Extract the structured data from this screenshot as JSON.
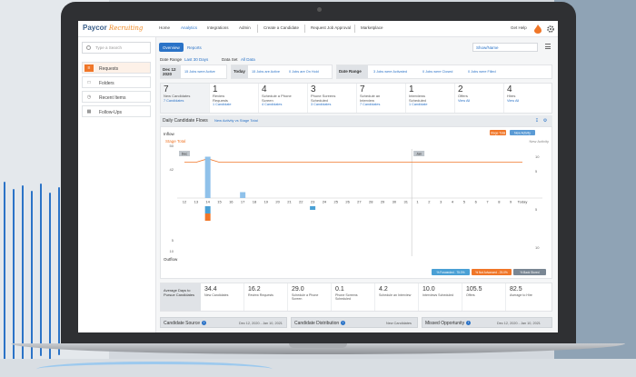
{
  "nav": {
    "logo_text": "Paycor",
    "logo_script": "Recruiting",
    "items": [
      "Home",
      "Analytics",
      "Integrations",
      "Admin",
      "Create a Candidate",
      "Request Job Approval",
      "Marketplace"
    ],
    "active_index": 1,
    "help": "Get Help"
  },
  "sidebar": {
    "search_placeholder": "Type a Search",
    "items": [
      {
        "label": "Requests",
        "icon": "requests-icon",
        "active": true
      },
      {
        "label": "Folders",
        "icon": "folder-icon",
        "active": false
      },
      {
        "label": "Recent Items",
        "icon": "clock-icon",
        "active": false
      },
      {
        "label": "Follow-Ups",
        "icon": "calendar-icon",
        "active": false
      }
    ]
  },
  "tabs": [
    "Overview",
    "Reports"
  ],
  "show_select": "Show/Name",
  "date_range": {
    "label": "Date Range",
    "value": "Last 30 Days",
    "set_label": "Data Set",
    "set_value": "All Data"
  },
  "periods": [
    {
      "head": "Dec 12 2020",
      "links": [
        "15 Jobs were Active"
      ]
    },
    {
      "head": "Today",
      "links": [
        "15 Jobs are Active",
        "0 Jobs are On Hold"
      ]
    },
    {
      "head": "Date Range",
      "links": [
        "3 Jobs were Activated",
        "0 Jobs were Closed",
        "0 Jobs were Filled"
      ]
    }
  ],
  "stats": [
    {
      "num": "7",
      "label": "New Candidates",
      "sub": "7 Candidates"
    },
    {
      "num": "1",
      "label": "Review Requests",
      "sub": "1 Candidate"
    },
    {
      "num": "4",
      "label": "Schedule a Phone Screen",
      "sub": "4 Candidates"
    },
    {
      "num": "3",
      "label": "Phone Screens Scheduled",
      "sub": "3 Candidates"
    },
    {
      "num": "7",
      "label": "Schedule an Interview",
      "sub": "7 Candidates"
    },
    {
      "num": "1",
      "label": "Interviews Scheduled",
      "sub": "1 Candidate"
    },
    {
      "num": "2",
      "label": "Offers",
      "sub": "View All"
    },
    {
      "num": "4",
      "label": "Hires",
      "sub": "View All"
    }
  ],
  "chart_head": {
    "title": "Daily Candidate Flows",
    "select": "New Activity vs Stage Total"
  },
  "chart_data": {
    "type": "bar",
    "legend_top": [
      "Stage Total",
      "New Activity"
    ],
    "legend_bottom": [
      "% Forwarded - 75.0%",
      "% Not Advanced - 25.0%",
      "% Back Stored"
    ],
    "inflow_label": "Inflow",
    "outflow_label": "Outflow",
    "stage_total_label": "Stage Total",
    "new_activity_label": "New Activity",
    "month_markers": [
      "Dec",
      "Jan"
    ],
    "y_left_ticks": [
      "50",
      "42",
      "5",
      "10"
    ],
    "y_right_ticks": [
      "10",
      "5",
      "5",
      "10"
    ],
    "categories": [
      "12",
      "13",
      "14",
      "15",
      "16",
      "17",
      "18",
      "19",
      "20",
      "21",
      "22",
      "23",
      "24",
      "25",
      "26",
      "27",
      "28",
      "29",
      "30",
      "31",
      "1",
      "2",
      "3",
      "4",
      "5",
      "6",
      "7",
      "8",
      "9",
      "Today"
    ],
    "stage_total": [
      38,
      38,
      41,
      38,
      38,
      38,
      38,
      38,
      38,
      38,
      38,
      38,
      38,
      38,
      38,
      38,
      38,
      38,
      38,
      38,
      38,
      38,
      38,
      38,
      38,
      38,
      38,
      38,
      38,
      38
    ],
    "inflow": [
      0,
      0,
      7,
      0,
      0,
      1,
      0,
      0,
      0,
      0,
      0,
      0,
      0,
      0,
      0,
      0,
      0,
      0,
      0,
      0,
      0,
      0,
      0,
      0,
      0,
      0,
      0,
      0,
      0,
      0
    ],
    "outflow": [
      0,
      0,
      4,
      0,
      0,
      0,
      0,
      0,
      0,
      0,
      0,
      1,
      0,
      0,
      0,
      0,
      0,
      0,
      0,
      0,
      0,
      0,
      0,
      0,
      0,
      0,
      0,
      0,
      0,
      0
    ],
    "colors": {
      "stage_total": "#f07628",
      "inflow": "#8fc1ea",
      "outflow_forward": "#4aa0d5",
      "outflow_not_advanced": "#f07628",
      "back": "#7a8794"
    }
  },
  "kpis": {
    "first": "Average Days to Pursue Candidates",
    "cells": [
      {
        "num": "34.4",
        "label": "New Candidates"
      },
      {
        "num": "16.2",
        "label": "Review Requests"
      },
      {
        "num": "29.0",
        "label": "Schedule a Phone Screen"
      },
      {
        "num": "0.1",
        "label": "Phone Screens Scheduled"
      },
      {
        "num": "4.2",
        "label": "Schedule an Interview"
      },
      {
        "num": "10.0",
        "label": "Interviews Scheduled"
      },
      {
        "num": "105.5",
        "label": "Offers"
      },
      {
        "num": "82.5",
        "label": "Average to Hire"
      }
    ]
  },
  "panels": [
    {
      "title": "Candidate Source",
      "range": "Dec 12, 2020 - Jan 10, 2021"
    },
    {
      "title": "Candidate Distribution",
      "range": "New Candidates"
    },
    {
      "title": "Missed Opportunity",
      "range": "Dec 12, 2020 - Jan 10, 2021"
    }
  ],
  "colors": {
    "accent": "#2b73c7",
    "brand_orange": "#f07628"
  }
}
